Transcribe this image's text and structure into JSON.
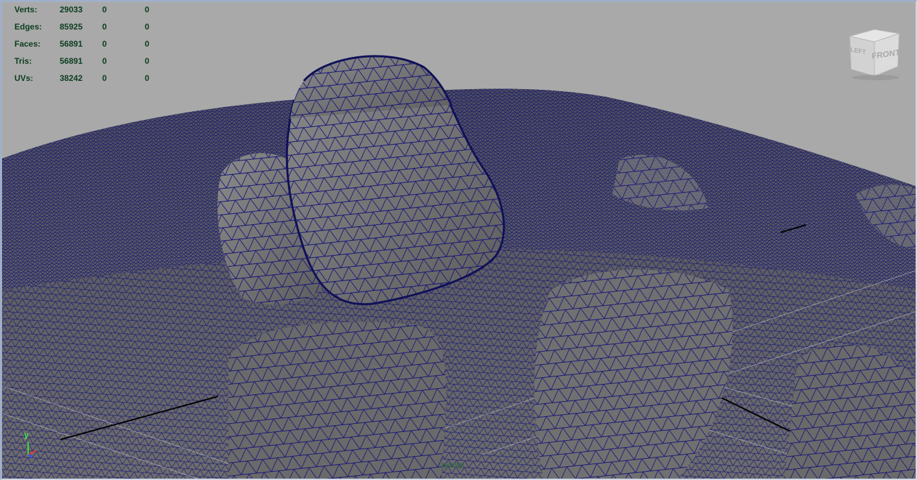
{
  "hud": {
    "rows": [
      {
        "label": "Verts:",
        "v1": "29033",
        "v2": "0",
        "v3": "0"
      },
      {
        "label": "Edges:",
        "v1": "85925",
        "v2": "0",
        "v3": "0"
      },
      {
        "label": "Faces:",
        "v1": "56891",
        "v2": "0",
        "v3": "0"
      },
      {
        "label": "Tris:",
        "v1": "56891",
        "v2": "0",
        "v3": "0"
      },
      {
        "label": "UVs:",
        "v1": "38242",
        "v2": "0",
        "v3": "0"
      }
    ]
  },
  "viewcube": {
    "front_label": "FRONT",
    "left_label": "LEFT"
  },
  "axis_gizmo": {
    "y_label": "y"
  },
  "camera": {
    "name": "persp"
  },
  "colors": {
    "background": "#a9a9a9",
    "mesh_fill": "#6b6b6b",
    "wireframe": "#141478",
    "hud_text": "#0b3d1f",
    "grid": "#c8c8c8"
  }
}
